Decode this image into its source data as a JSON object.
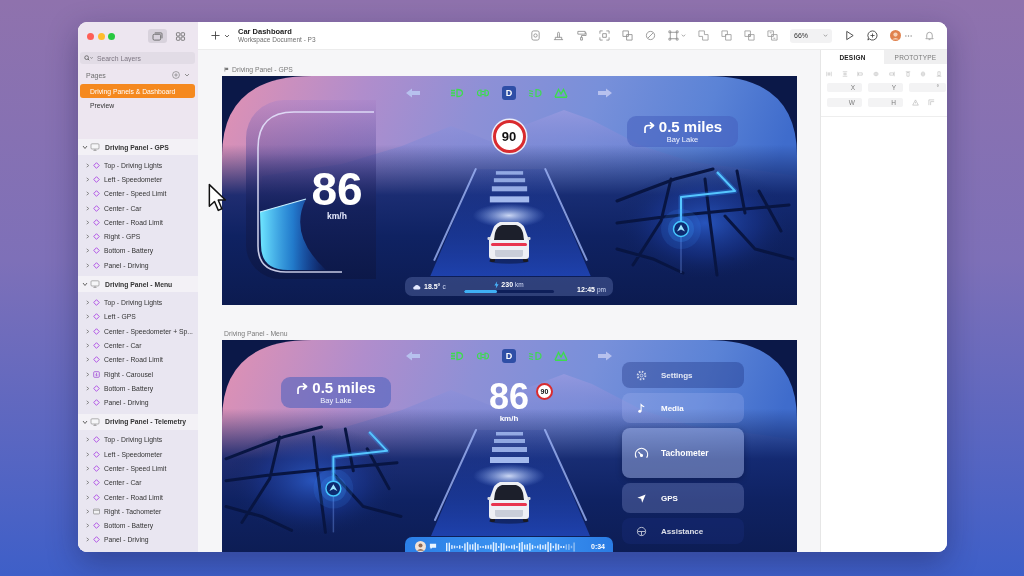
{
  "window": {
    "title": "Car Dashboard",
    "subtitle": "Workspace Document - P3"
  },
  "sidebar": {
    "view_toggles": [
      {
        "kind": "layers",
        "selected": true
      },
      {
        "kind": "grid",
        "selected": false
      }
    ],
    "search": {
      "placeholder": "Search Layers"
    },
    "pages": {
      "title": "Pages",
      "items": [
        {
          "label": "Driving Panels & Dashboard",
          "selected": true
        },
        {
          "label": "Preview",
          "selected": false
        }
      ]
    },
    "layers": [
      {
        "label": "Driving Panel - GPS",
        "expanded": true,
        "children": [
          {
            "label": "Top - Driving Lights",
            "kind": "component",
            "expanded": false
          },
          {
            "label": "Left - Speedometer",
            "kind": "component",
            "expanded": false
          },
          {
            "label": "Center - Speed Limit",
            "kind": "component",
            "expanded": false
          },
          {
            "label": "Center - Car",
            "kind": "component",
            "expanded": false
          },
          {
            "label": "Center - Road Limit",
            "kind": "component",
            "expanded": false
          },
          {
            "label": "Right - GPS",
            "kind": "component",
            "expanded": false
          },
          {
            "label": "Bottom - Battery",
            "kind": "component",
            "expanded": false
          },
          {
            "label": "Panel - Driving",
            "kind": "component",
            "expanded": false
          }
        ]
      },
      {
        "label": "Driving Panel - Menu",
        "expanded": true,
        "children": [
          {
            "label": "Top - Driving Lights",
            "kind": "component",
            "expanded": false
          },
          {
            "label": "Left - GPS",
            "kind": "component",
            "expanded": false
          },
          {
            "label": "Center - Speedometer + Sp...",
            "kind": "component",
            "expanded": false
          },
          {
            "label": "Center - Car",
            "kind": "component",
            "expanded": false
          },
          {
            "label": "Center - Road Limit",
            "kind": "component",
            "expanded": false
          },
          {
            "label": "Right - Carousel",
            "kind": "carousel",
            "expanded": false
          },
          {
            "label": "Bottom - Battery",
            "kind": "component",
            "expanded": false
          },
          {
            "label": "Panel - Driving",
            "kind": "component",
            "expanded": false
          }
        ]
      },
      {
        "label": "Driving Panel - Telemetry",
        "expanded": true,
        "children": [
          {
            "label": "Top - Driving Lights",
            "kind": "component",
            "expanded": false
          },
          {
            "label": "Left - Speedometer",
            "kind": "component",
            "expanded": false
          },
          {
            "label": "Center - Speed Limit",
            "kind": "component",
            "expanded": false
          },
          {
            "label": "Center - Car",
            "kind": "component",
            "expanded": false
          },
          {
            "label": "Center - Road Limit",
            "kind": "component",
            "expanded": false
          },
          {
            "label": "Right - Tachometer",
            "kind": "frame",
            "expanded": false
          },
          {
            "label": "Bottom - Battery",
            "kind": "component",
            "expanded": false
          },
          {
            "label": "Panel - Driving",
            "kind": "component",
            "expanded": false
          }
        ]
      }
    ]
  },
  "toolbar": {
    "zoom": "66%"
  },
  "inspector": {
    "tabs": [
      {
        "label": "DESIGN",
        "selected": true
      },
      {
        "label": "PROTOTYPE",
        "selected": false
      }
    ],
    "position_fields": [
      {
        "label": "X"
      },
      {
        "label": "Y"
      },
      {
        "label": "°"
      }
    ],
    "size_fields": [
      {
        "label": "W"
      },
      {
        "label": "H"
      }
    ]
  },
  "canvas": {
    "frames": [
      {
        "label": "Driving Panel - GPS",
        "flag": true,
        "kind": "gps",
        "indicators": [
          {
            "kind": "turn-left",
            "on": false
          },
          {
            "kind": "headlights",
            "on": true
          },
          {
            "kind": "side-lights",
            "on": true
          },
          {
            "kind": "gear",
            "label": "D",
            "on": true
          },
          {
            "kind": "low-beam",
            "on": true
          },
          {
            "kind": "lane",
            "on": true
          },
          {
            "kind": "turn-right",
            "on": false
          }
        ],
        "speed_limit": "90",
        "speed": "86",
        "speed_unit": "km/h",
        "navigation": {
          "distance": "0.5 miles",
          "place": "Bay Lake"
        },
        "trip": {
          "temperature": "18.5°",
          "temperature_unit": "c",
          "range": "230",
          "range_unit": "km",
          "level": 0.37,
          "time": "12:45",
          "time_suffix": "pm"
        }
      },
      {
        "label": "Driving Panel - Menu",
        "flag": false,
        "kind": "menu",
        "indicators": [
          {
            "kind": "turn-left",
            "on": false
          },
          {
            "kind": "headlights",
            "on": true
          },
          {
            "kind": "side-lights",
            "on": true
          },
          {
            "kind": "gear",
            "label": "D",
            "on": true
          },
          {
            "kind": "low-beam",
            "on": true
          },
          {
            "kind": "lane",
            "on": true
          },
          {
            "kind": "turn-right",
            "on": false
          }
        ],
        "navigation": {
          "distance": "0.5 miles",
          "place": "Bay Lake"
        },
        "speed": "86",
        "speed_unit": "km/h",
        "speed_limit": "90",
        "menu": [
          {
            "label": "Settings",
            "kind": "settings",
            "selected": false
          },
          {
            "label": "Media",
            "kind": "media",
            "selected": false
          },
          {
            "label": "Tachometer",
            "kind": "tachometer",
            "selected": true
          },
          {
            "label": "GPS",
            "kind": "gps",
            "selected": false
          },
          {
            "label": "Assistance",
            "kind": "assistance",
            "selected": false
          }
        ],
        "media": {
          "time": "0:34"
        }
      }
    ]
  }
}
